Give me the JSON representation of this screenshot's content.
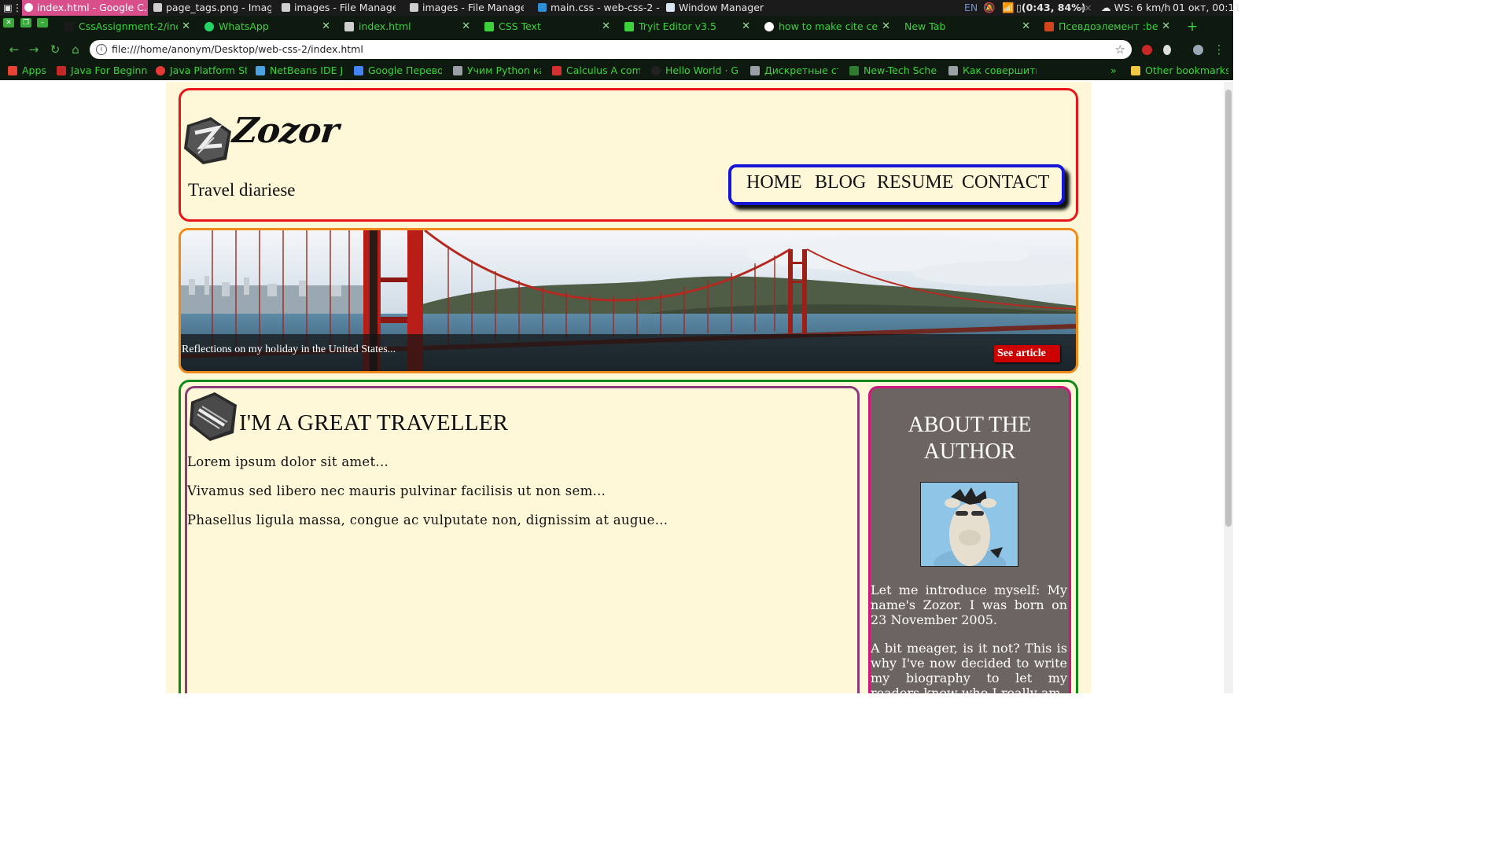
{
  "os_taskbar": {
    "windows": [
      {
        "title": "index.html - Google C...",
        "active": true
      },
      {
        "title": "page_tags.png - Imag..."
      },
      {
        "title": "images - File Manager"
      },
      {
        "title": "images - File Manager"
      },
      {
        "title": "main.css - web-css-2 - ..."
      },
      {
        "title": "Window Manager"
      }
    ],
    "tray": {
      "lang": "EN",
      "battery": "(0:43, 84%)",
      "weather": "WS: 6 km/h",
      "datetime": "01 окт, 00:11"
    }
  },
  "browser": {
    "tabs": [
      {
        "title": "CssAssignment-2/inde",
        "favicon_color": "#1a1a1a"
      },
      {
        "title": "WhatsApp",
        "favicon_color": "#25d366"
      },
      {
        "title": "index.html",
        "favicon_color": "#cfcfcf",
        "active": true
      },
      {
        "title": "CSS Text",
        "favicon_color": "#3cd23c"
      },
      {
        "title": "Tryit Editor v3.5",
        "favicon_color": "#3cd23c"
      },
      {
        "title": "how to make cite cent",
        "favicon_color": "#4285f4"
      },
      {
        "title": "New Tab",
        "favicon_color": "#0e1a10"
      },
      {
        "title": "Псевдоэлемент :befo",
        "favicon_color": "#d0451b"
      }
    ],
    "url": "file:///home/anonym/Desktop/web-css-2/index.html",
    "bookmarks": [
      {
        "label": "Apps",
        "color": "#e84235"
      },
      {
        "label": "Java For Beginne",
        "color": "#c62828"
      },
      {
        "label": "Java Platform St",
        "color": "#e53935"
      },
      {
        "label": "NetBeans IDE Ja",
        "color": "#4aa3df"
      },
      {
        "label": "Google Перево",
        "color": "#4285f4"
      },
      {
        "label": "Учим Python ка",
        "color": "#9aa0a6"
      },
      {
        "label": "Calculus A comp",
        "color": "#d32f2f"
      },
      {
        "label": "Hello World · Gi",
        "color": "#222222"
      },
      {
        "label": "Дискретные ст",
        "color": "#9aa0a6"
      },
      {
        "label": "New-Tech Schec",
        "color": "#2e7d32"
      },
      {
        "label": "Как совершить",
        "color": "#9aa0a6"
      }
    ],
    "bookmarks_overflow": "»",
    "other_bookmarks": "Other bookmarks"
  },
  "site": {
    "logo_text": "Zozor",
    "tagline": "Travel diariese",
    "nav": [
      "HOME",
      "BLOG",
      "RESUME",
      "CONTACT"
    ],
    "banner": {
      "caption": "Reflections on my holiday in the United States...",
      "button": "See article"
    },
    "article": {
      "title": "I'M A GREAT TRAVELLER",
      "paragraphs": [
        "Lorem ipsum dolor sit amet...",
        "Vivamus sed libero nec mauris pulvinar facilisis ut non sem...",
        "Phasellus ligula massa, congue ac vulputate non, dignissim at augue..."
      ]
    },
    "aside": {
      "title": "ABOUT THE AUTHOR",
      "paragraphs": [
        "Let me introduce myself: My name's Zozor. I was born on 23 November 2005.",
        "A bit meager, is it not? This is why I've now decided to write my biography to let my readers know who I really am."
      ]
    }
  },
  "colors": {
    "header_border": "#e8161b",
    "nav_border": "#1515d8",
    "banner_border": "#f08a1c",
    "content_border": "#11891a",
    "article_border": "#8a3d7a",
    "aside_border": "#d0187c",
    "aside_bg": "#6c6460",
    "page_bg": "#fff8d8",
    "button_red": "#cc0000"
  }
}
